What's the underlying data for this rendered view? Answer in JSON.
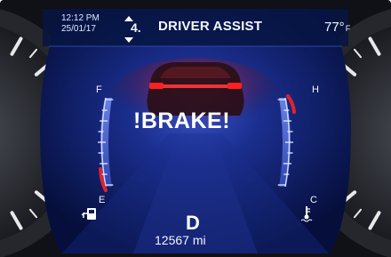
{
  "status": {
    "time": "12:12 PM",
    "date": "25/01/17",
    "menu_index": "4.",
    "title": "DRIVER ASSIST",
    "outside_temp": "77°",
    "temp_unit": "F"
  },
  "alert": {
    "text": "!BRAKE!"
  },
  "fuel_gauge": {
    "full_label": "F",
    "empty_label": "E"
  },
  "coolant_gauge": {
    "hot_label": "H",
    "cold_label": "C"
  },
  "drive": {
    "gear": "D",
    "odometer": "12567 mi"
  },
  "icons": {
    "menu_nav": "up-down-arrows-icon",
    "fuel": "fuel-pump-icon",
    "coolant": "coolant-temperature-icon",
    "vehicle": "car-rear-icon"
  },
  "colors": {
    "display_background": "#0b1a5c",
    "gauge_blue": "#4f6bd6",
    "warning_red": "#d8202a",
    "text": "#f2f5ff"
  }
}
